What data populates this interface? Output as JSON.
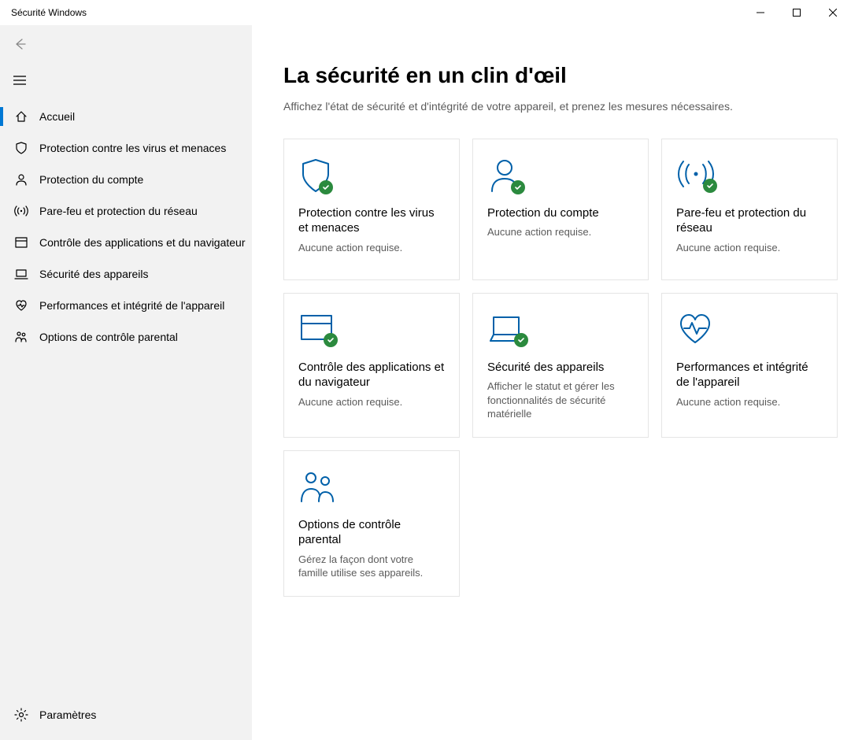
{
  "window_title": "Sécurité Windows",
  "nav": {
    "accueil": "Accueil",
    "virus": "Protection contre les virus et menaces",
    "compte": "Protection du compte",
    "parefeu": "Pare-feu et protection du réseau",
    "appctrl": "Contrôle des applications et du navigateur",
    "appareil": "Sécurité des appareils",
    "perf": "Performances et intégrité de l'appareil",
    "parental": "Options de contrôle parental",
    "parametres": "Paramètres"
  },
  "header": {
    "title": "La sécurité en un clin d'œil",
    "subtitle": "Affichez l'état de sécurité et d'intégrité de votre appareil, et prenez les mesures nécessaires."
  },
  "tiles": {
    "virus_title": "Protection contre les virus et menaces",
    "virus_desc": "Aucune action requise.",
    "compte_title": "Protection du compte",
    "compte_desc": "Aucune action requise.",
    "parefeu_title": "Pare-feu et protection du réseau",
    "parefeu_desc": "Aucune action requise.",
    "appctrl_title": "Contrôle des applications et du navigateur",
    "appctrl_desc": "Aucune action requise.",
    "appareil_title": "Sécurité des appareils",
    "appareil_desc": "Afficher le statut et gérer les fonctionnalités de sécurité matérielle",
    "perf_title": "Performances et intégrité de l'appareil",
    "perf_desc": "Aucune action requise.",
    "parental_title": "Options de contrôle parental",
    "parental_desc": "Gérez la façon dont votre famille utilise ses appareils."
  }
}
